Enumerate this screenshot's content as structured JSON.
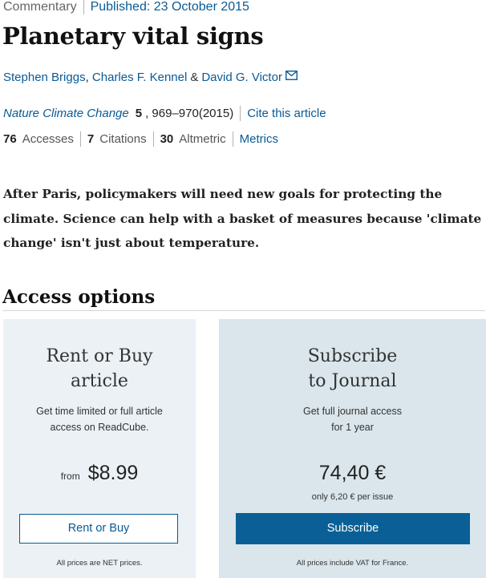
{
  "header": {
    "type": "Commentary",
    "published": "Published: 23 October 2015"
  },
  "article": {
    "title": "Planetary vital signs",
    "authors": [
      "Stephen Briggs",
      "Charles F. Kennel",
      "David G. Victor"
    ],
    "authors_and": "&",
    "journal": "Nature Climate Change",
    "volume": "5",
    "pages": ", 969–970(2015)",
    "cite_label": "Cite this article",
    "abstract": "After Paris, policymakers will need new goals for protecting the climate. Science can help with a basket of measures because 'climate change' isn't just about temperature."
  },
  "metrics": {
    "accesses_count": "76",
    "accesses_label": "Accesses",
    "citations_count": "7",
    "citations_label": "Citations",
    "altmetric_count": "30",
    "altmetric_label": "Altmetric",
    "metrics_link": "Metrics"
  },
  "access": {
    "heading": "Access options",
    "rent": {
      "title_line1": "Rent or Buy",
      "title_line2": "article",
      "desc_line1": "Get time limited or full article",
      "desc_line2": "access on ReadCube.",
      "price_prefix": "from",
      "price": "$8.99",
      "button": "Rent or Buy",
      "fine_print": "All prices are NET prices."
    },
    "subscribe": {
      "title_line1": "Subscribe",
      "title_line2": "to Journal",
      "desc_line1": "Get full journal access",
      "desc_line2": "for 1 year",
      "price": "74,40 €",
      "price_note": "only 6,20 € per issue",
      "button": "Subscribe",
      "fine_print": "All prices include VAT for France."
    }
  },
  "colors": {
    "link": "#0a5a96",
    "button_primary": "#0a6096",
    "card_rent_bg": "#ebf1f5",
    "card_subscribe_bg": "#dae6ec"
  },
  "icons": {
    "email": "email-icon"
  }
}
